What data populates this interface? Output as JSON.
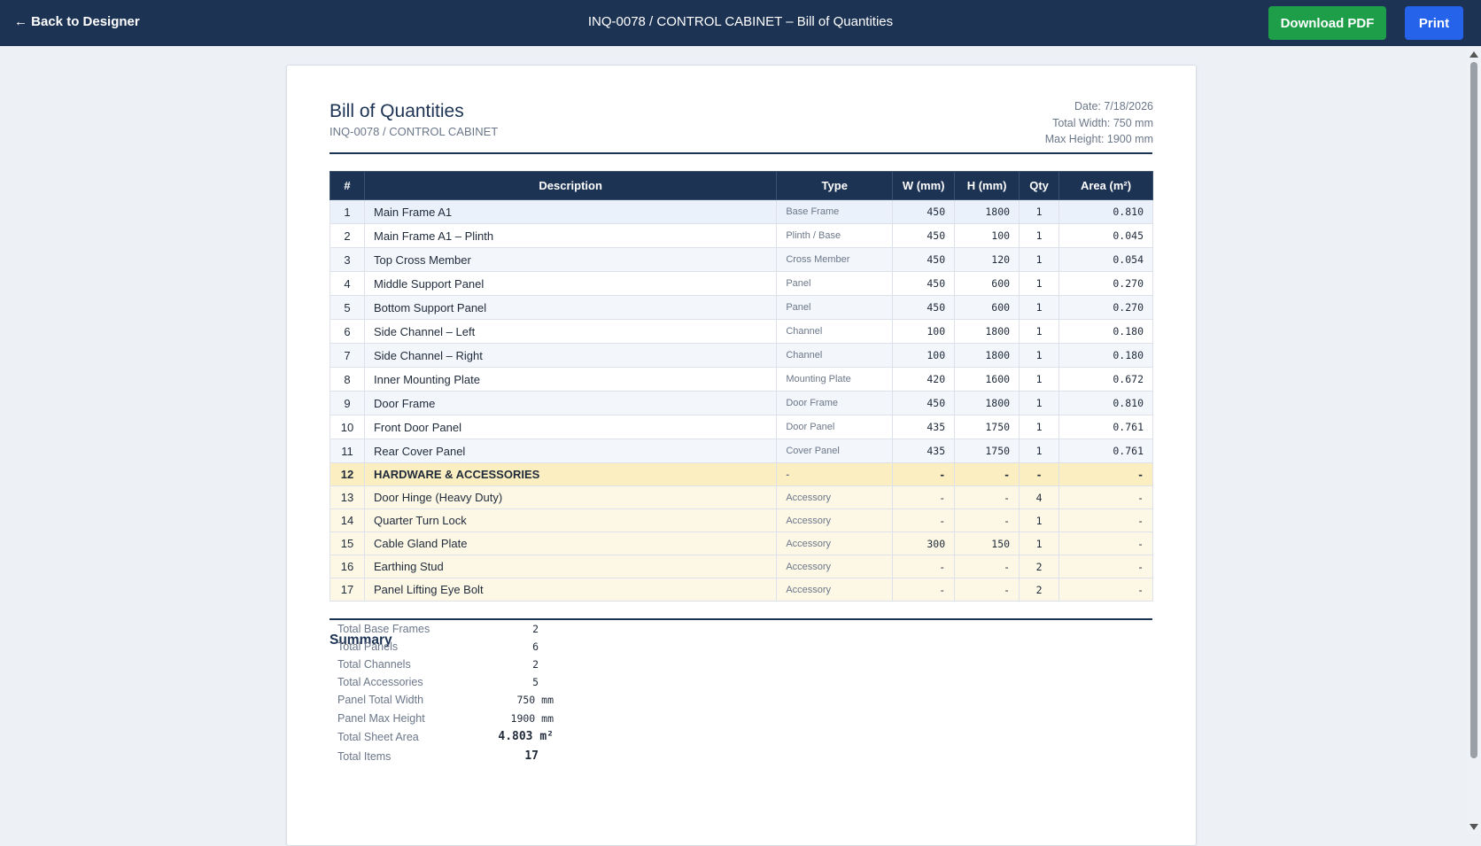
{
  "topbar": {
    "back_label": "← Back to Designer",
    "title": "INQ-0078 / CONTROL CABINET – Bill of Quantities",
    "download_label": "Download PDF",
    "print_label": "Print"
  },
  "doc": {
    "title": "Bill of Quantities",
    "subtitle": "INQ-0078 / CONTROL CABINET",
    "date": "Date: 7/18/2026",
    "total_width": "Total Width: 750 mm",
    "max_height": "Max Height: 1900 mm"
  },
  "table": {
    "headers": [
      "#",
      "Description",
      "Type",
      "W (mm)",
      "H (mm)",
      "Qty",
      "Area (m²)"
    ],
    "rows": [
      {
        "kind": "part",
        "n": "1",
        "desc": "Main Frame A1",
        "type": "Base Frame",
        "w": "450",
        "h": "1800",
        "qty": "1",
        "area": "0.810"
      },
      {
        "kind": "part",
        "n": "2",
        "desc": "Main Frame A1 – Plinth",
        "type": "Plinth / Base",
        "w": "450",
        "h": "100",
        "qty": "1",
        "area": "0.045"
      },
      {
        "kind": "part",
        "n": "3",
        "desc": "Top Cross Member",
        "type": "Cross Member",
        "w": "450",
        "h": "120",
        "qty": "1",
        "area": "0.054"
      },
      {
        "kind": "part",
        "n": "4",
        "desc": "Middle Support Panel",
        "type": "Panel",
        "w": "450",
        "h": "600",
        "qty": "1",
        "area": "0.270"
      },
      {
        "kind": "part",
        "n": "5",
        "desc": "Bottom Support Panel",
        "type": "Panel",
        "w": "450",
        "h": "600",
        "qty": "1",
        "area": "0.270"
      },
      {
        "kind": "part",
        "n": "6",
        "desc": "Side Channel – Left",
        "type": "Channel",
        "w": "100",
        "h": "1800",
        "qty": "1",
        "area": "0.180"
      },
      {
        "kind": "part",
        "n": "7",
        "desc": "Side Channel – Right",
        "type": "Channel",
        "w": "100",
        "h": "1800",
        "qty": "1",
        "area": "0.180"
      },
      {
        "kind": "part",
        "n": "8",
        "desc": "Inner Mounting Plate",
        "type": "Mounting Plate",
        "w": "420",
        "h": "1600",
        "qty": "1",
        "area": "0.672"
      },
      {
        "kind": "part",
        "n": "9",
        "desc": "Door Frame",
        "type": "Door Frame",
        "w": "450",
        "h": "1800",
        "qty": "1",
        "area": "0.810"
      },
      {
        "kind": "part",
        "n": "10",
        "desc": "Front Door Panel",
        "type": "Door Panel",
        "w": "435",
        "h": "1750",
        "qty": "1",
        "area": "0.761"
      },
      {
        "kind": "part",
        "n": "11",
        "desc": "Rear Cover Panel",
        "type": "Cover Panel",
        "w": "435",
        "h": "1750",
        "qty": "1",
        "area": "0.761"
      },
      {
        "kind": "section",
        "n": "12",
        "desc": "HARDWARE & ACCESSORIES",
        "type": "-",
        "w": "-",
        "h": "-",
        "qty": "-",
        "area": "-"
      },
      {
        "kind": "acc",
        "n": "13",
        "desc": "Door Hinge (Heavy Duty)",
        "type": "Accessory",
        "w": "-",
        "h": "-",
        "qty": "4",
        "area": "-"
      },
      {
        "kind": "acc",
        "n": "14",
        "desc": "Quarter Turn Lock",
        "type": "Accessory",
        "w": "-",
        "h": "-",
        "qty": "1",
        "area": "-"
      },
      {
        "kind": "acc",
        "n": "15",
        "desc": "Cable Gland Plate",
        "type": "Accessory",
        "w": "300",
        "h": "150",
        "qty": "1",
        "area": "-"
      },
      {
        "kind": "acc",
        "n": "16",
        "desc": "Earthing Stud",
        "type": "Accessory",
        "w": "-",
        "h": "-",
        "qty": "2",
        "area": "-"
      },
      {
        "kind": "acc",
        "n": "17",
        "desc": "Panel Lifting Eye Bolt",
        "type": "Accessory",
        "w": "-",
        "h": "-",
        "qty": "2",
        "area": "-"
      }
    ]
  },
  "summary": {
    "title": "Summary",
    "items": [
      {
        "label": "Total Base Frames",
        "value": "2"
      },
      {
        "label": "Total Panels",
        "value": "6"
      },
      {
        "label": "Total Channels",
        "value": "2"
      },
      {
        "label": "Total Accessories",
        "value": "5"
      },
      {
        "label": "Panel Total Width",
        "value": "750 mm"
      },
      {
        "label": "Panel Max Height",
        "value": "1900 mm"
      },
      {
        "label": "Total Sheet Area",
        "value": "4.803 m²"
      },
      {
        "label": "Total Items",
        "value": "17"
      }
    ]
  },
  "colors": {
    "navy": "#1d3354",
    "download_green": "#1f9e4a",
    "print_blue": "#2563eb",
    "section_yellow": "#fbeec0",
    "accessory_cream": "#fdf8e6"
  }
}
